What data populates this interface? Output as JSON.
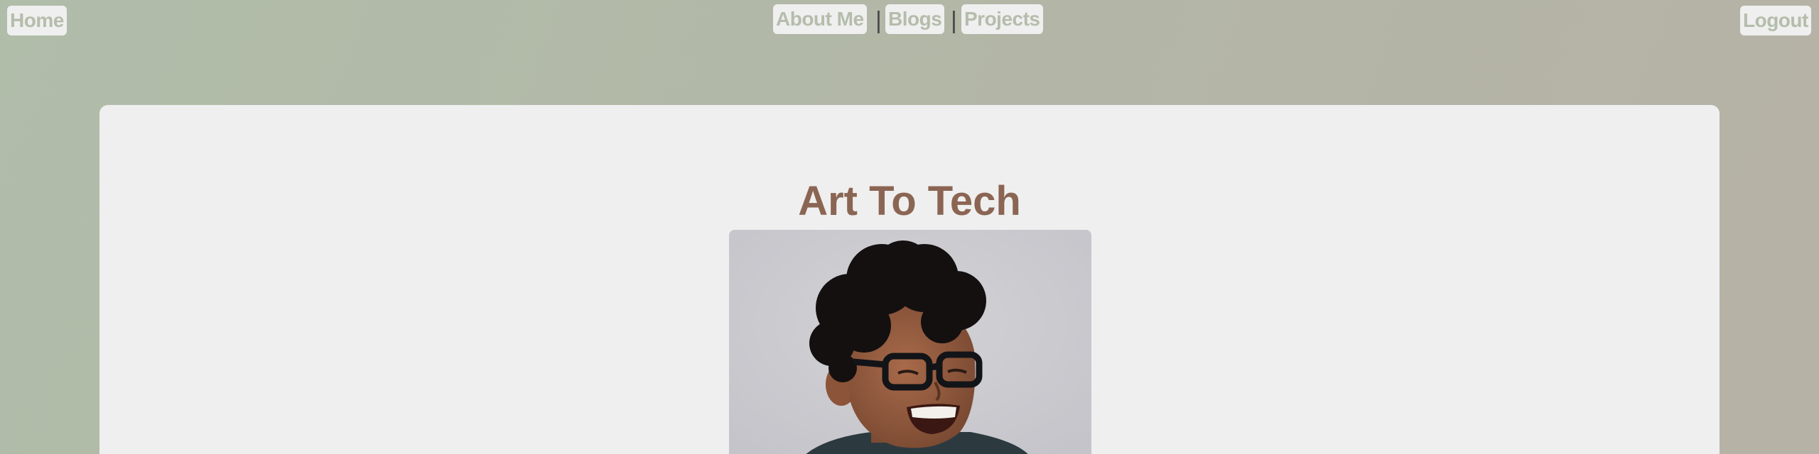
{
  "nav": {
    "home_label": "Home",
    "about_label": "About Me",
    "blogs_label": "Blogs",
    "projects_label": "Projects",
    "logout_label": "Logout",
    "separator": "|"
  },
  "main": {
    "title": "Art To Tech"
  },
  "colors": {
    "background": "#b1bba9",
    "card": "#efefef",
    "title": "#8b6553",
    "nav_text": "#b4bdab"
  }
}
